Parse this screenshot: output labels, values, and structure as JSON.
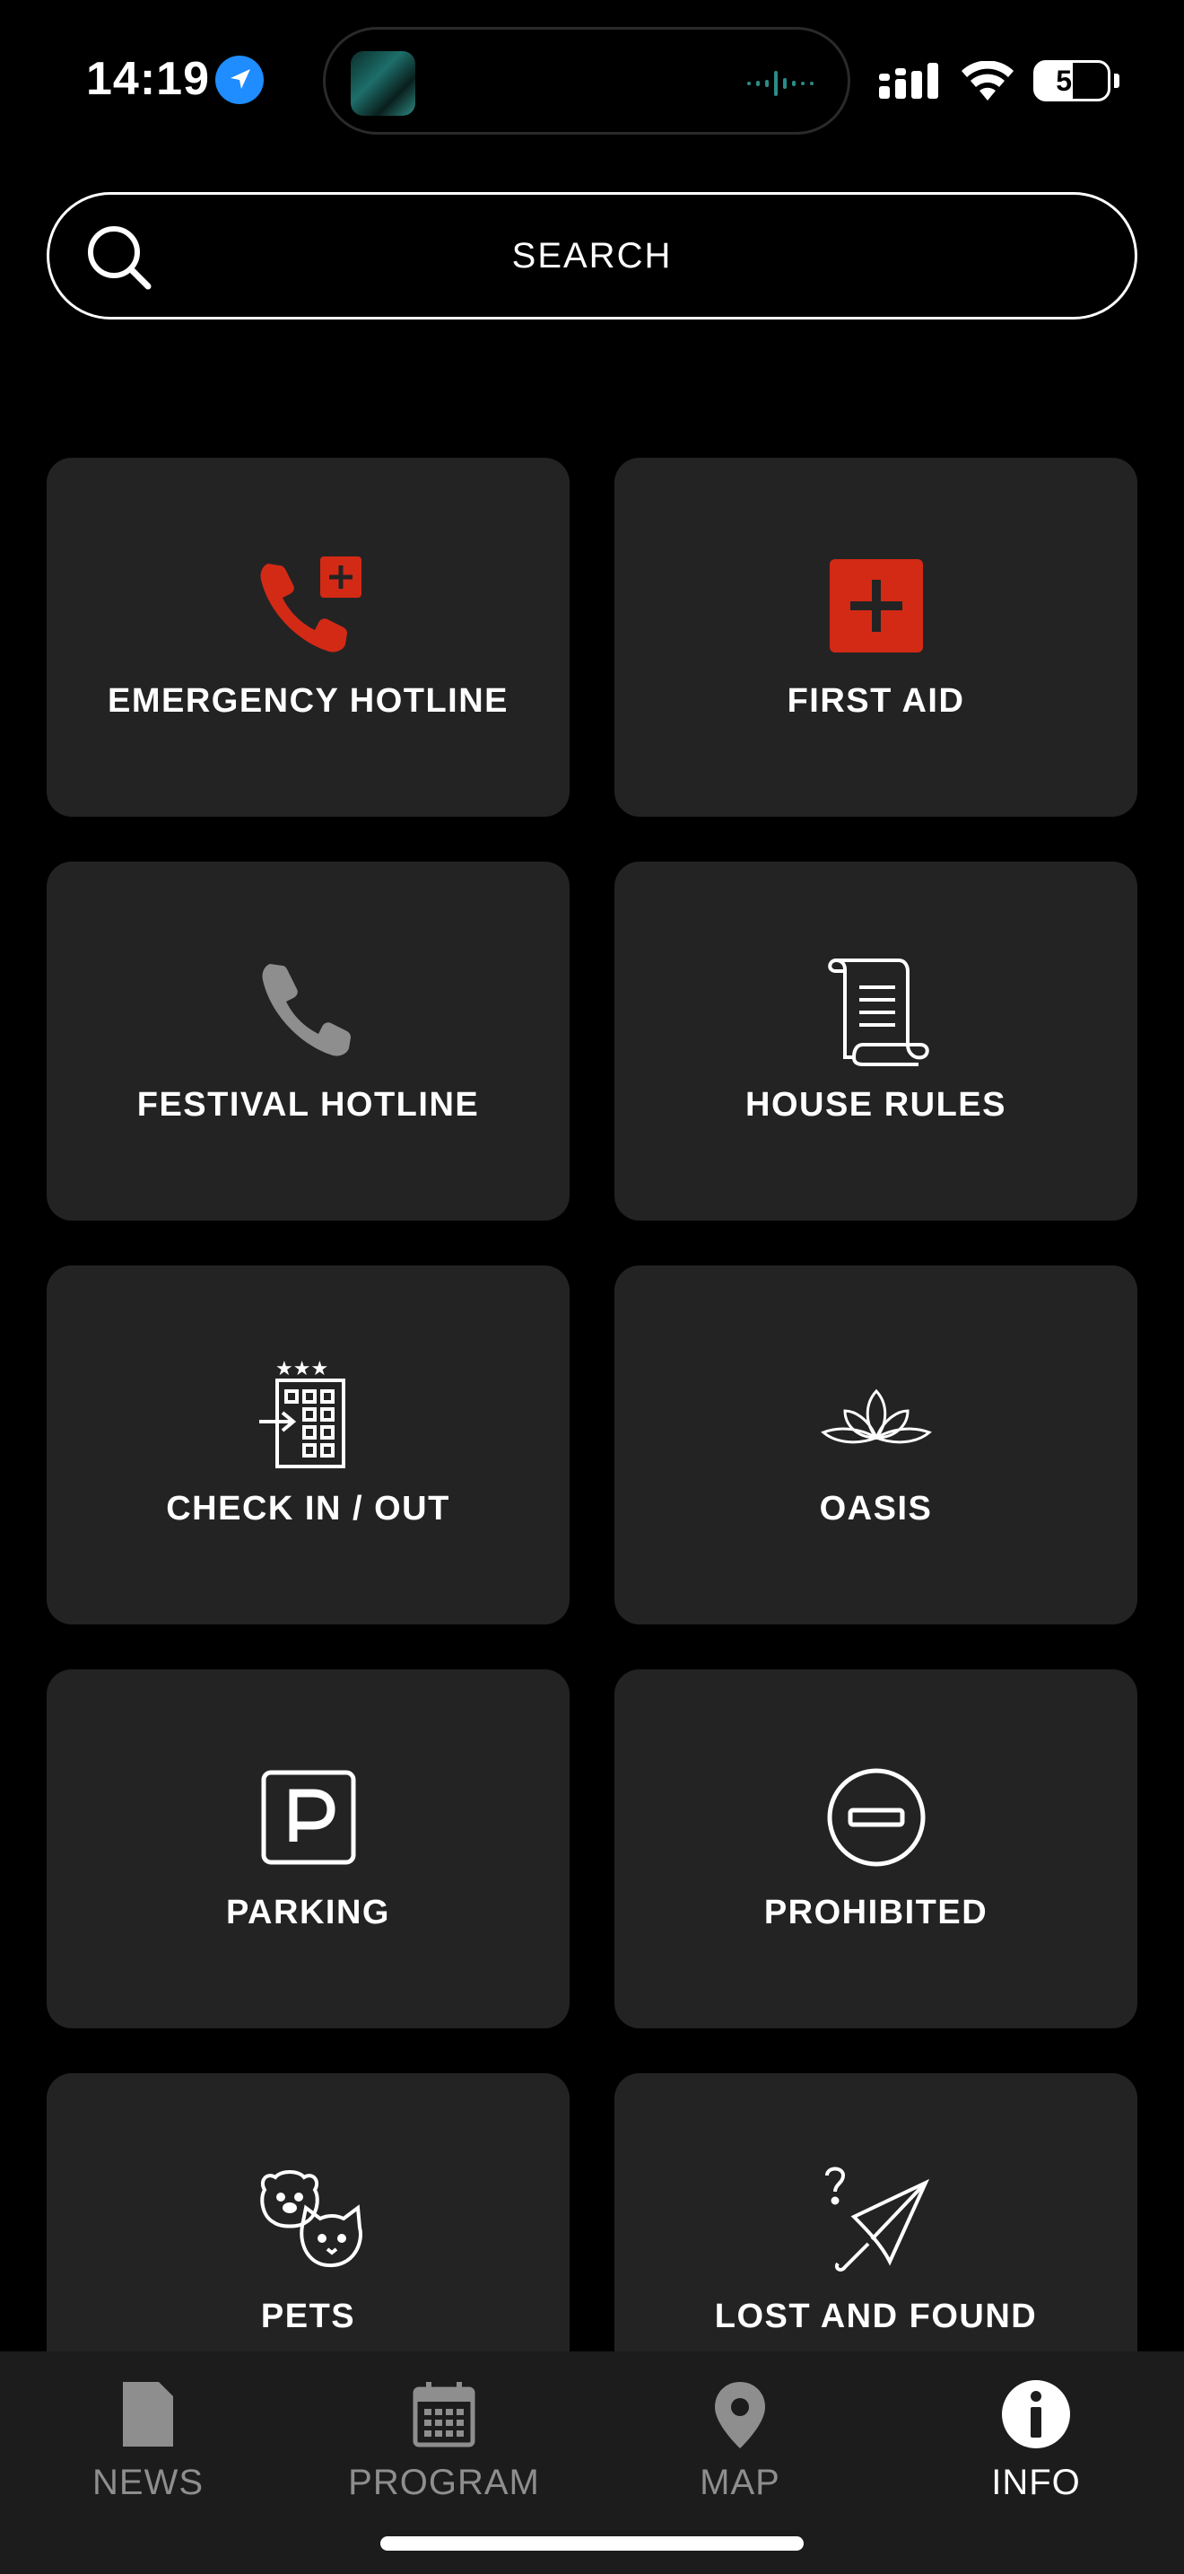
{
  "status_bar": {
    "time": "14:19",
    "battery": "51"
  },
  "search": {
    "placeholder": "SEARCH"
  },
  "tiles": [
    {
      "label": "EMERGENCY HOTLINE",
      "icon": "emergency-phone-icon"
    },
    {
      "label": "FIRST AID",
      "icon": "first-aid-icon"
    },
    {
      "label": "FESTIVAL HOTLINE",
      "icon": "phone-icon"
    },
    {
      "label": "HOUSE RULES",
      "icon": "scroll-icon"
    },
    {
      "label": "CHECK IN / OUT",
      "icon": "hotel-checkin-icon"
    },
    {
      "label": "OASIS",
      "icon": "lotus-icon"
    },
    {
      "label": "PARKING",
      "icon": "parking-icon"
    },
    {
      "label": "PROHIBITED",
      "icon": "prohibited-icon"
    },
    {
      "label": "PETS",
      "icon": "pets-icon"
    },
    {
      "label": "LOST AND FOUND",
      "icon": "lost-umbrella-icon"
    }
  ],
  "tabbar": {
    "tabs": [
      {
        "label": "NEWS",
        "icon": "news-icon",
        "active": false
      },
      {
        "label": "PROGRAM",
        "icon": "calendar-icon",
        "active": false
      },
      {
        "label": "MAP",
        "icon": "map-pin-icon",
        "active": false
      },
      {
        "label": "INFO",
        "icon": "info-icon",
        "active": true
      }
    ]
  },
  "colors": {
    "background": "#000000",
    "tile": "#232323",
    "accent_red": "#d32a16",
    "inactive": "#8e8e8e"
  }
}
